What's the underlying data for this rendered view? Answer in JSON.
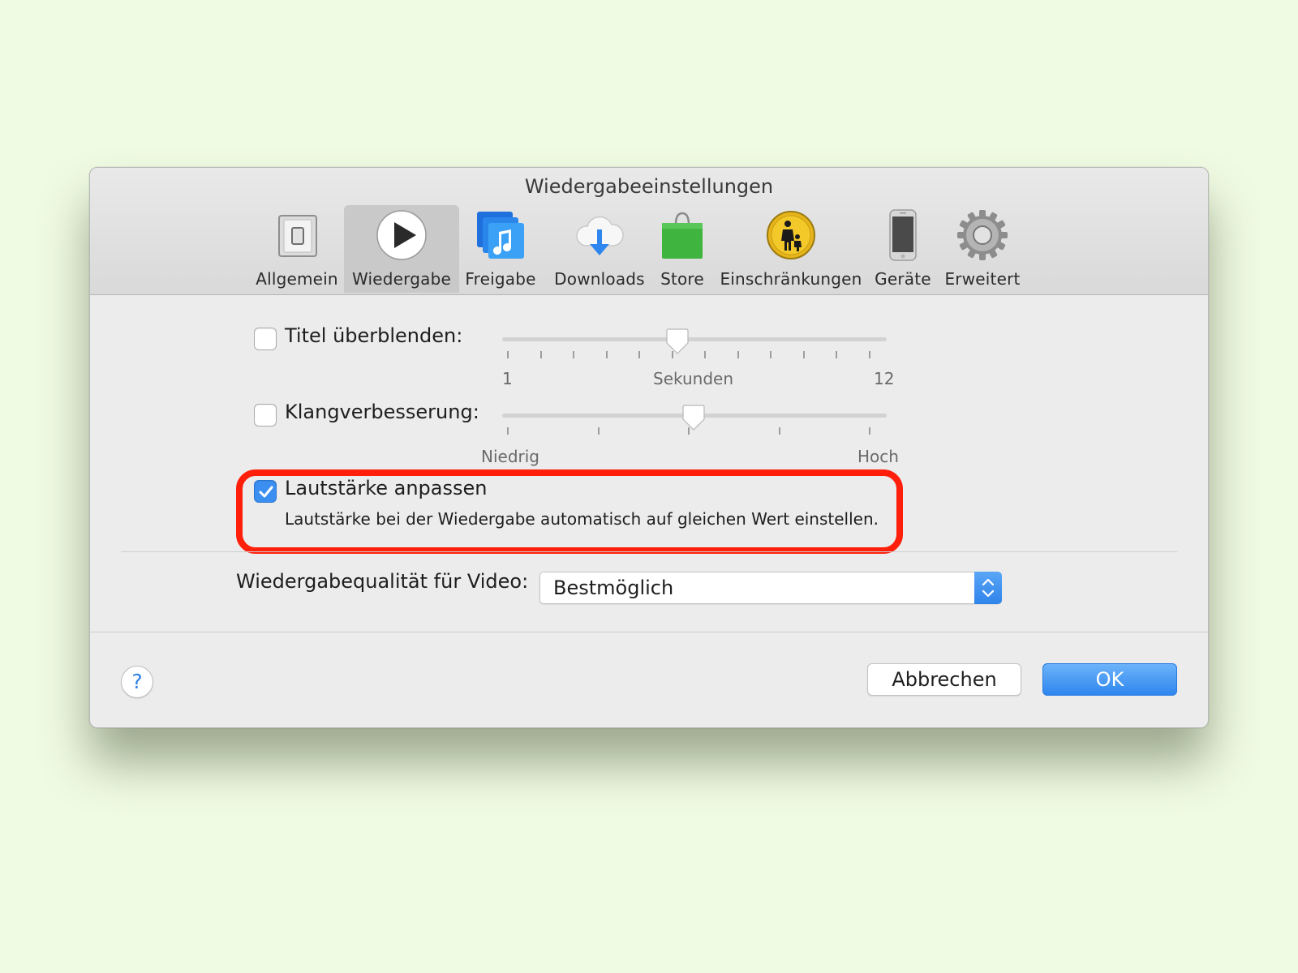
{
  "window": {
    "title": "Wiedergabeeinstellungen"
  },
  "toolbar": {
    "items": [
      {
        "label": "Allgemein",
        "icon": "switch-icon"
      },
      {
        "label": "Wiedergabe",
        "icon": "play-icon",
        "selected": true
      },
      {
        "label": "Freigabe",
        "icon": "music-library-icon"
      },
      {
        "label": "Downloads",
        "icon": "cloud-download-icon"
      },
      {
        "label": "Store",
        "icon": "shopping-bag-icon"
      },
      {
        "label": "Einschränkungen",
        "icon": "parental-controls-icon"
      },
      {
        "label": "Geräte",
        "icon": "iphone-icon"
      },
      {
        "label": "Erweitert",
        "icon": "gear-icon"
      }
    ]
  },
  "crossfade": {
    "label": "Titel überblenden:",
    "checked": false,
    "min_label": "1",
    "unit_label": "Sekunden",
    "max_label": "12",
    "value": 6
  },
  "sound_enhancer": {
    "label": "Klangverbesserung:",
    "checked": false,
    "min_label": "Niedrig",
    "max_label": "Hoch",
    "value": 0.5
  },
  "sound_check": {
    "label": "Lautstärke anpassen",
    "checked": true,
    "description": "Lautstärke bei der Wiedergabe automatisch auf gleichen Wert einstellen."
  },
  "video_quality": {
    "label": "Wiedergabequalität für Video:",
    "selected": "Bestmöglich"
  },
  "buttons": {
    "help": "?",
    "cancel": "Abbrechen",
    "ok": "OK"
  },
  "colors": {
    "accent": "#3b8ff0",
    "highlight": "#ff1f0a",
    "background": "#f0fbe3"
  }
}
